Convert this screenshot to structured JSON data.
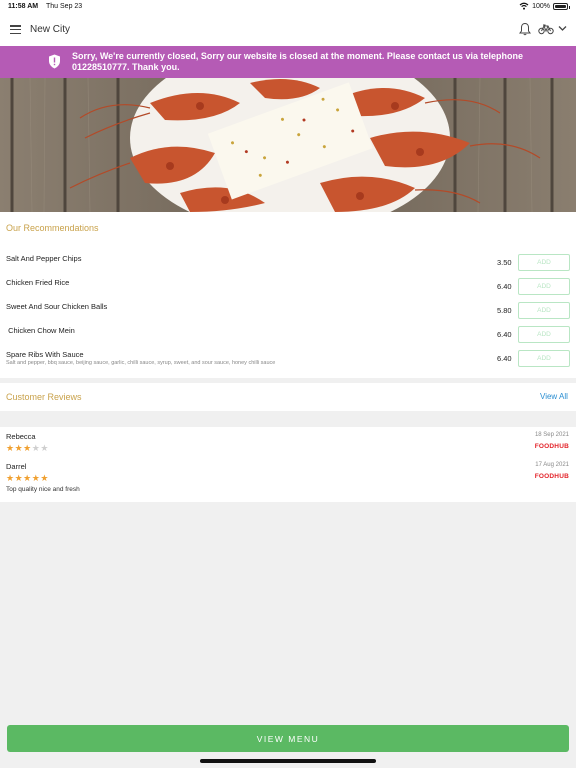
{
  "status_bar": {
    "time": "11:58 AM",
    "date": "Thu Sep 23",
    "battery": "100%",
    "battery_level": 1.0
  },
  "header": {
    "title": "New City",
    "icons": [
      "menu-icon",
      "bell-icon",
      "bike-icon",
      "chevron-down-icon"
    ]
  },
  "banner": {
    "icon": "alert-shield-icon",
    "text": "Sorry, We're currently closed, Sorry our website is closed at the moment. Please contact us via telephone 01228510777. Thank you.",
    "color": "#b55bb5"
  },
  "recommendations": {
    "title": "Our Recommendations",
    "items": [
      {
        "name": "Salt And Pepper Chips",
        "description": "",
        "price": "3.50",
        "add_label": "ADD"
      },
      {
        "name": "Chicken Fried Rice",
        "description": "",
        "price": "6.40",
        "add_label": "ADD"
      },
      {
        "name": "Sweet And Sour Chicken Balls",
        "description": "",
        "price": "5.80",
        "add_label": "ADD"
      },
      {
        "name": " Chicken Chow Mein",
        "description": "",
        "price": "6.40",
        "add_label": "ADD"
      },
      {
        "name": "Spare Ribs With Sauce",
        "description": "Salt and pepper, bbq sauce, beijing sauce, garlic, chilli sauce, syrup, sweet, and sour sauce, honey chilli sauce",
        "price": "6.40",
        "add_label": "ADD"
      }
    ]
  },
  "reviews": {
    "title": "Customer Reviews",
    "view_all": "View All",
    "items": [
      {
        "name": "Rebecca",
        "rating": 3,
        "max": 5,
        "date": "18 Sep 2021",
        "source": "FOODHUB",
        "text": ""
      },
      {
        "name": "Darrel",
        "rating": 5,
        "max": 5,
        "date": "17 Aug 2021",
        "source": "FOODHUB",
        "text": "Top quality nice and fresh"
      }
    ]
  },
  "footer": {
    "view_menu_label": "VIEW MENU",
    "button_color": "#5bb963"
  },
  "colors": {
    "accent_gold": "#c9a24b",
    "link_blue": "#2a8ed1",
    "add_border": "#b9e6c4",
    "foodhub_red": "#e3232a"
  }
}
